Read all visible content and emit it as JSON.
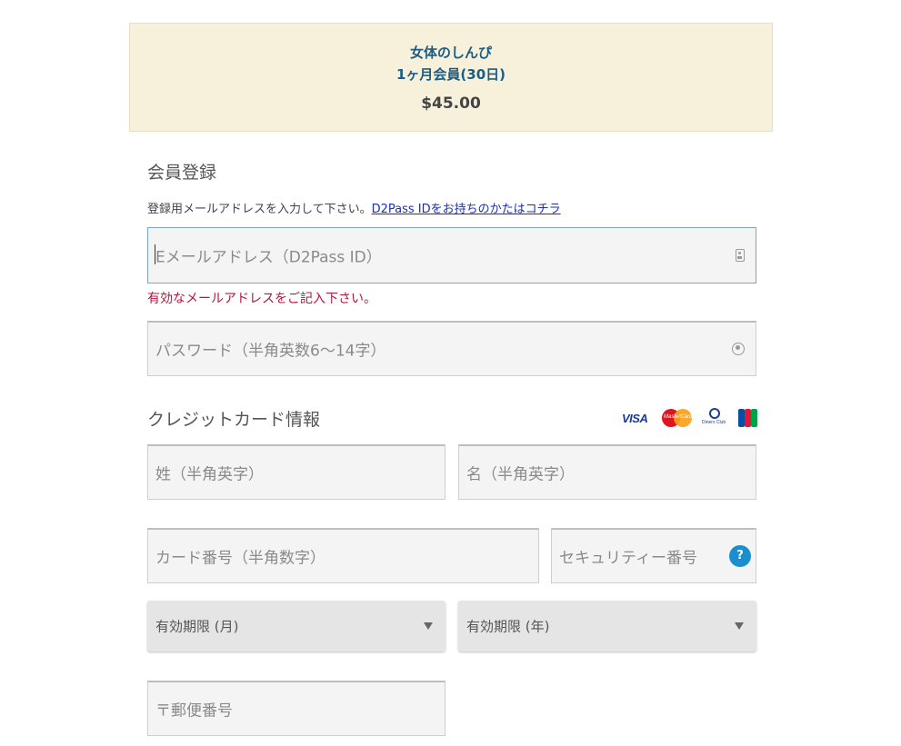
{
  "summary": {
    "site": "女体のしんぴ",
    "plan": "1ヶ月会員(30日)",
    "price": "$45.00"
  },
  "register": {
    "title": "会員登録",
    "note": "登録用メールアドレスを入力して下さい。",
    "d2pass_link": "D2Pass IDをお持ちのかたはコチラ",
    "email_placeholder": "Eメールアドレス（D2Pass ID）",
    "email_error": "有効なメールアドレスをご記入下さい。",
    "password_placeholder": "パスワード（半角英数6～14字）"
  },
  "card": {
    "title": "クレジットカード情報",
    "brands": {
      "visa": "VISA",
      "mastercard": "MasterCard",
      "diners": "Diners Club"
    },
    "last_name_placeholder": "姓（半角英字）",
    "first_name_placeholder": "名（半角英字）",
    "number_placeholder": "カード番号（半角数字）",
    "security_placeholder": "セキュリティー番号",
    "help_glyph": "?",
    "exp_month_label": "有効期限 (月)",
    "exp_year_label": "有効期限 (年)",
    "postal_placeholder": "〒郵便番号"
  }
}
